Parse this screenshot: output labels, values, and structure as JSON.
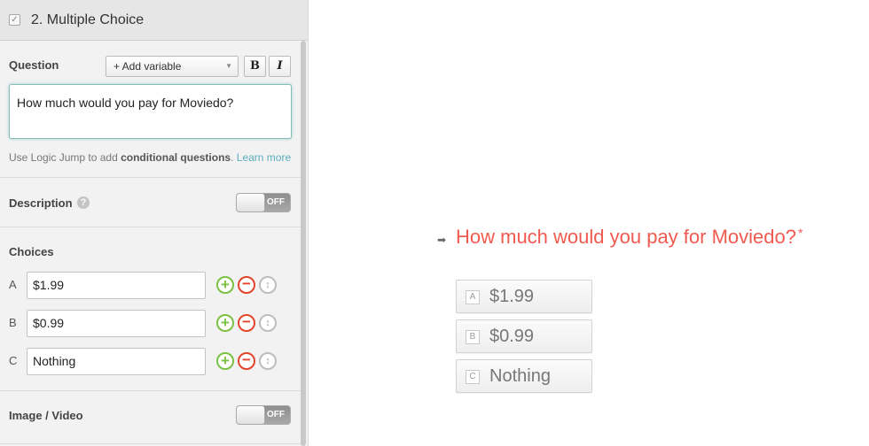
{
  "panel": {
    "header_title": "2. Multiple Choice",
    "question": {
      "label": "Question",
      "add_variable": "+ Add variable",
      "bold_label": "B",
      "italic_label": "I",
      "text": "How much would you pay for Moviedo?",
      "hint_prefix": "Use Logic Jump to add ",
      "hint_bold": "conditional questions",
      "hint_suffix": ".",
      "learn_more": "Learn more"
    },
    "description": {
      "label": "Description",
      "help": "?",
      "toggle_state": "OFF"
    },
    "choices": {
      "label": "Choices",
      "items": [
        {
          "letter": "A",
          "value": "$1.99"
        },
        {
          "letter": "B",
          "value": "$0.99"
        },
        {
          "letter": "C",
          "value": "Nothing"
        }
      ],
      "add_glyph": "+",
      "remove_glyph": "−",
      "move_glyph": "↕"
    },
    "image_video": {
      "label": "Image / Video",
      "toggle_state": "OFF"
    }
  },
  "preview": {
    "arrow": "➡",
    "question": "How much would you pay for Moviedo?",
    "required_mark": "*",
    "choices": [
      {
        "key": "A",
        "label": "$1.99"
      },
      {
        "key": "B",
        "label": "$0.99"
      },
      {
        "key": "C",
        "label": "Nothing"
      }
    ]
  },
  "colors": {
    "accent_red": "#f05a50",
    "add_green": "#7bc143",
    "remove_red": "#e2452b",
    "link_teal": "#5aaebf"
  }
}
